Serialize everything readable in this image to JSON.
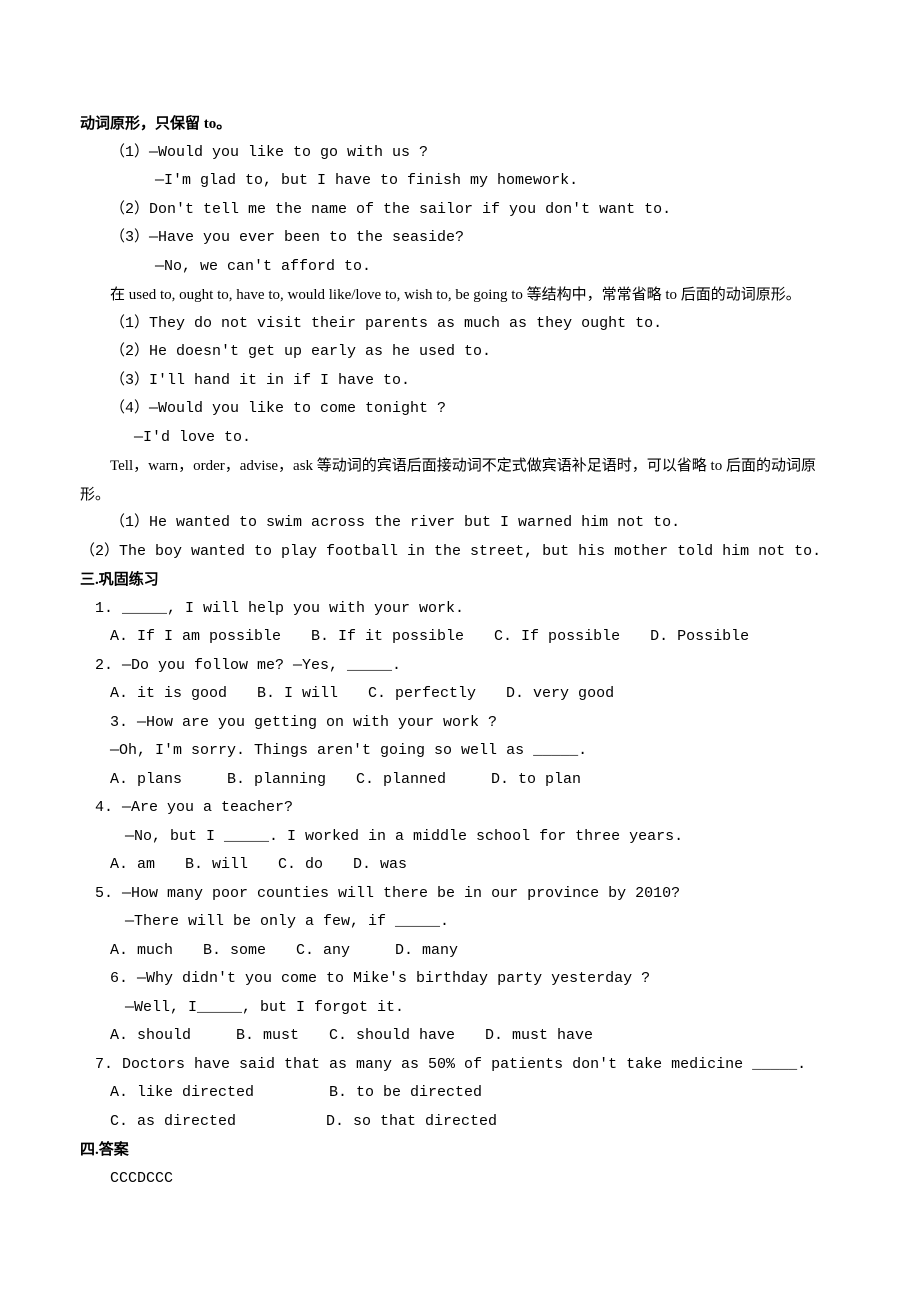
{
  "section_intro_title": "动词原形，只保留 to。",
  "intro_examples": [
    "（1）—Would you like to go with us ?",
    "　　—I'm glad to, but I have to finish my homework.",
    "（2）Don't tell me the name of the sailor if you don't want to.",
    "（3）—Have you ever been to the seaside?",
    "　　—No, we can't afford to."
  ],
  "note1": "在 used to, ought to, have to, would like/love to, wish to, be going to 等结构中，常常省略 to 后面的动词原形。",
  "note1_examples": [
    "（1）They do not visit their parents as much as they ought to.",
    "（2）He doesn't get up early as he used to.",
    "（3）I'll hand it in if I have to.",
    "（4）—Would you like to come tonight ?",
    "　 —I'd love to."
  ],
  "note2": "Tell，warn，order，advise，ask 等动词的宾语后面接动词不定式做宾语补足语时，可以省略 to 后面的动词原形。",
  "note2_examples": [
    "（1）He wanted to swim across the river but I warned him not to.",
    "（2）The boy wanted to play football in the street, but his mother told him not to."
  ],
  "section3_title": "三.巩固练习",
  "questions": [
    {
      "q": "1. _____, I will help you with your work.",
      "opts": "A. If I am possible　　B. If it possible　　C. If possible　　D. Possible"
    },
    {
      "q": "2. —Do you follow me? —Yes, _____.",
      "opts": "A. it is good　　B. I will　　C. perfectly　　D. very good"
    },
    {
      "q": "3. —How are you getting on with your work ?",
      "q2": "—Oh, I'm sorry. Things aren't going so well as _____.",
      "opts": "A. plans　　　B. planning　　C. planned　　　D. to plan"
    },
    {
      "q": "4. —Are you a teacher?",
      "q2": "—No, but I _____. I worked in a middle school for three years.",
      "opts": "A. am　　B. will　　C. do　　D. was"
    },
    {
      "q": "5. —How many poor counties will there be in our province by 2010?",
      "q2": "—There will be only a few, if _____.",
      "opts": "A. much　　B. some　　C. any　　　D. many"
    },
    {
      "q": "6. —Why didn't you come to Mike's birthday party yesterday ?",
      "q2": "—Well, I_____, but I forgot it.",
      "opts": "A. should　　　B. must　　C. should have　　D. must have"
    },
    {
      "q": "7. Doctors have said that as many as 50% of patients don't take medicine _____.",
      "opts1": "A. like directed　　　　　B. to be directed",
      "opts2": "C. as directed　　　　　　D. so that directed"
    }
  ],
  "section4_title": "四.答案",
  "answers": "CCCDCCC"
}
